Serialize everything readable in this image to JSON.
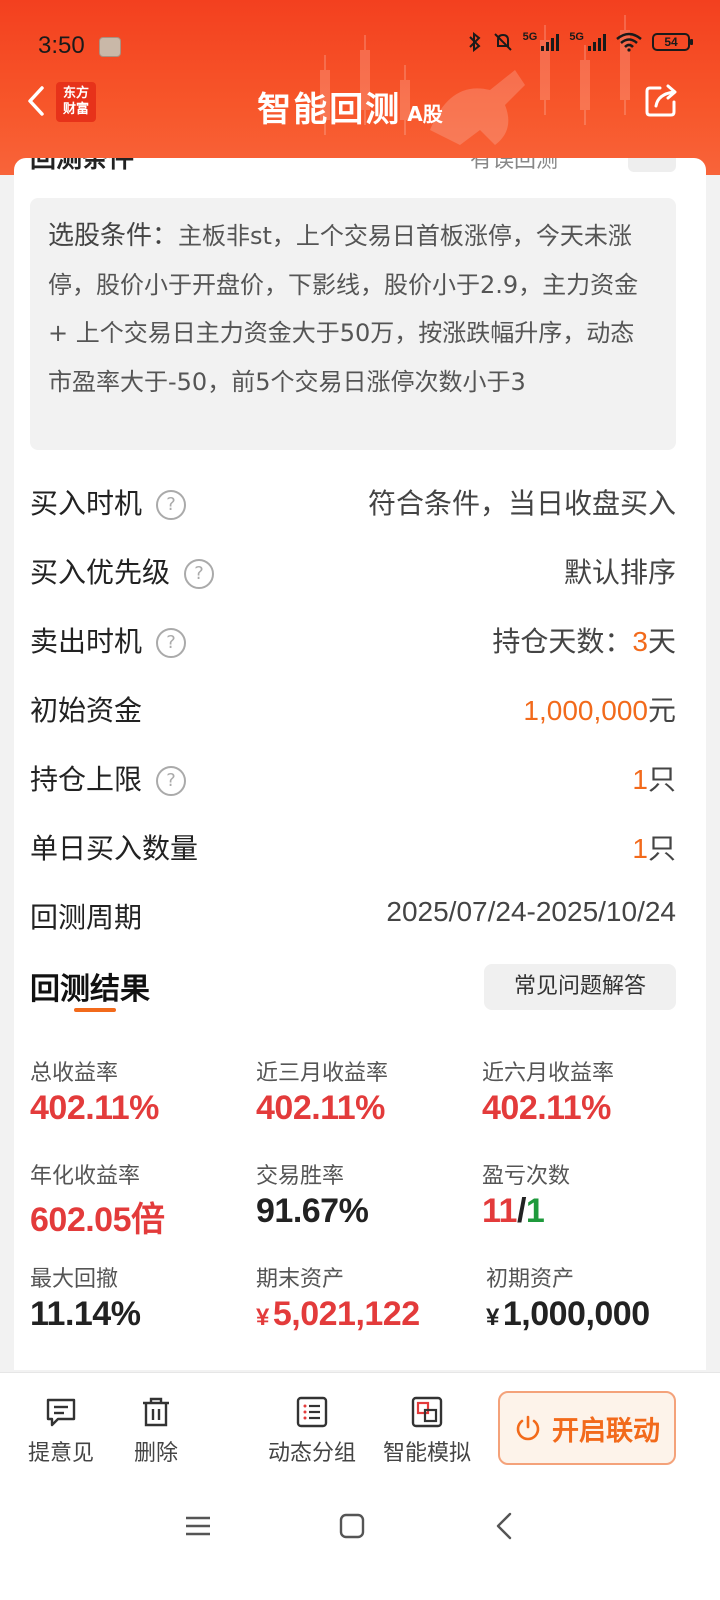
{
  "status_bar": {
    "time": "3:50",
    "battery": "54",
    "net1": "5G",
    "net2": "5G"
  },
  "header": {
    "logo": "东方\n财富",
    "title": "智能回测",
    "title_suffix": "A股"
  },
  "peek": {
    "left": "回测条件",
    "right": "有误回测"
  },
  "conditions": {
    "label": "选股条件：",
    "text": "主板非st，上个交易日首板涨停，今天未涨停，股价小于开盘价，下影线，股价小于2.9，主力资金 + 上个交易日主力资金大于50万，按涨跌幅升序，动态市盈率大于-50，前5个交易日涨停次数小于3"
  },
  "settings": {
    "buy_timing": {
      "label": "买入时机",
      "value": "符合条件，当日收盘买入"
    },
    "buy_priority": {
      "label": "买入优先级",
      "value": "默认排序"
    },
    "sell_timing": {
      "label": "卖出时机",
      "prefix": "持仓天数：",
      "number": "3",
      "unit": "天"
    },
    "initial_capital": {
      "label": "初始资金",
      "number": "1,000,000",
      "unit": "元"
    },
    "position_limit": {
      "label": "持仓上限",
      "number": "1",
      "unit": "只"
    },
    "daily_buy_count": {
      "label": "单日买入数量",
      "number": "1",
      "unit": "只"
    },
    "period": {
      "label": "回测周期",
      "value": "2025/07/24-2025/10/24"
    }
  },
  "results": {
    "title": "回测结果",
    "faq": "常见问题解答",
    "total_return": {
      "label": "总收益率",
      "value": "402.11%"
    },
    "return_3m": {
      "label": "近三月收益率",
      "value": "402.11%"
    },
    "return_6m": {
      "label": "近六月收益率",
      "value": "402.11%"
    },
    "annualized": {
      "label": "年化收益率",
      "value": "602.05倍"
    },
    "win_rate": {
      "label": "交易胜率",
      "value": "91.67%"
    },
    "win_loss": {
      "label": "盈亏次数",
      "wins": "11",
      "sep": "/",
      "losses": "1"
    },
    "max_drawdown": {
      "label": "最大回撤",
      "value": "11.14%"
    },
    "final_assets": {
      "label": "期末资产",
      "currency": "¥",
      "value": "5,021,122"
    },
    "initial_assets": {
      "label": "初期资产",
      "currency": "¥",
      "value": "1,000,000"
    }
  },
  "toolbar": {
    "feedback": "提意见",
    "delete": "删除",
    "dynamic_group": "动态分组",
    "smart_sim": "智能模拟",
    "linkage": "开启联动"
  },
  "colors": {
    "brand": "#f3401f",
    "accent": "#f26a1b",
    "gain": "#e33b3b",
    "loss": "#1f9a3c"
  }
}
